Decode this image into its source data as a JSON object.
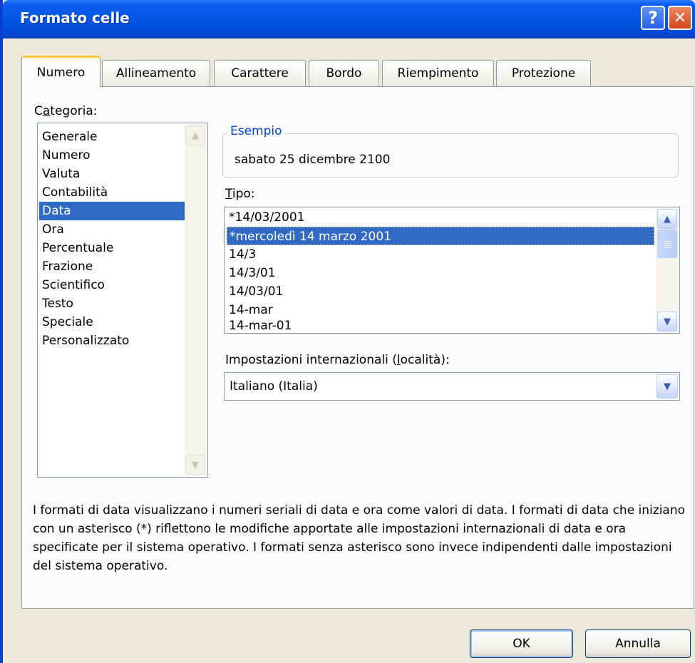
{
  "window": {
    "title": "Formato celle",
    "help_glyph": "?",
    "close_glyph": "✕"
  },
  "tabs": [
    {
      "label": "Numero",
      "active": true
    },
    {
      "label": "Allineamento",
      "active": false
    },
    {
      "label": "Carattere",
      "active": false
    },
    {
      "label": "Bordo",
      "active": false
    },
    {
      "label": "Riempimento",
      "active": false
    },
    {
      "label": "Protezione",
      "active": false
    }
  ],
  "category": {
    "label_pre": "C",
    "label_accel": "a",
    "label_post": "tegoria:",
    "items": [
      "Generale",
      "Numero",
      "Valuta",
      "Contabilità",
      "Data",
      "Ora",
      "Percentuale",
      "Frazione",
      "Scientifico",
      "Testo",
      "Speciale",
      "Personalizzato"
    ],
    "selected": "Data"
  },
  "sample": {
    "legend": "Esempio",
    "value": "sabato 25 dicembre 2100"
  },
  "type": {
    "label_accel": "T",
    "label_post": "ipo:",
    "items": [
      "*14/03/2001",
      "*mercoledì 14 marzo 2001",
      "14/3",
      "14/3/01",
      "14/03/01",
      "14-mar",
      "14-mar-01"
    ],
    "selected": "*mercoledì 14 marzo 2001"
  },
  "locale": {
    "label_pre": "Impostazioni internazionali (",
    "label_accel": "l",
    "label_post": "ocalità):",
    "value": "Italiano (Italia)"
  },
  "description": "I formati di data visualizzano i numeri seriali di data e ora come valori di data. I formati di data che iniziano con un asterisco (*) riflettono le modifiche apportate alle impostazioni internazionali di data e ora specificate per il sistema operativo. I formati senza asterisco sono invece indipendenti dalle impostazioni del sistema operativo.",
  "buttons": {
    "ok": "OK",
    "cancel": "Annulla"
  },
  "colors": {
    "title_bar": "#0456e4",
    "selection": "#316ac5",
    "dialog_bg": "#ece9d8",
    "tab_highlight": "#ffc83c"
  }
}
